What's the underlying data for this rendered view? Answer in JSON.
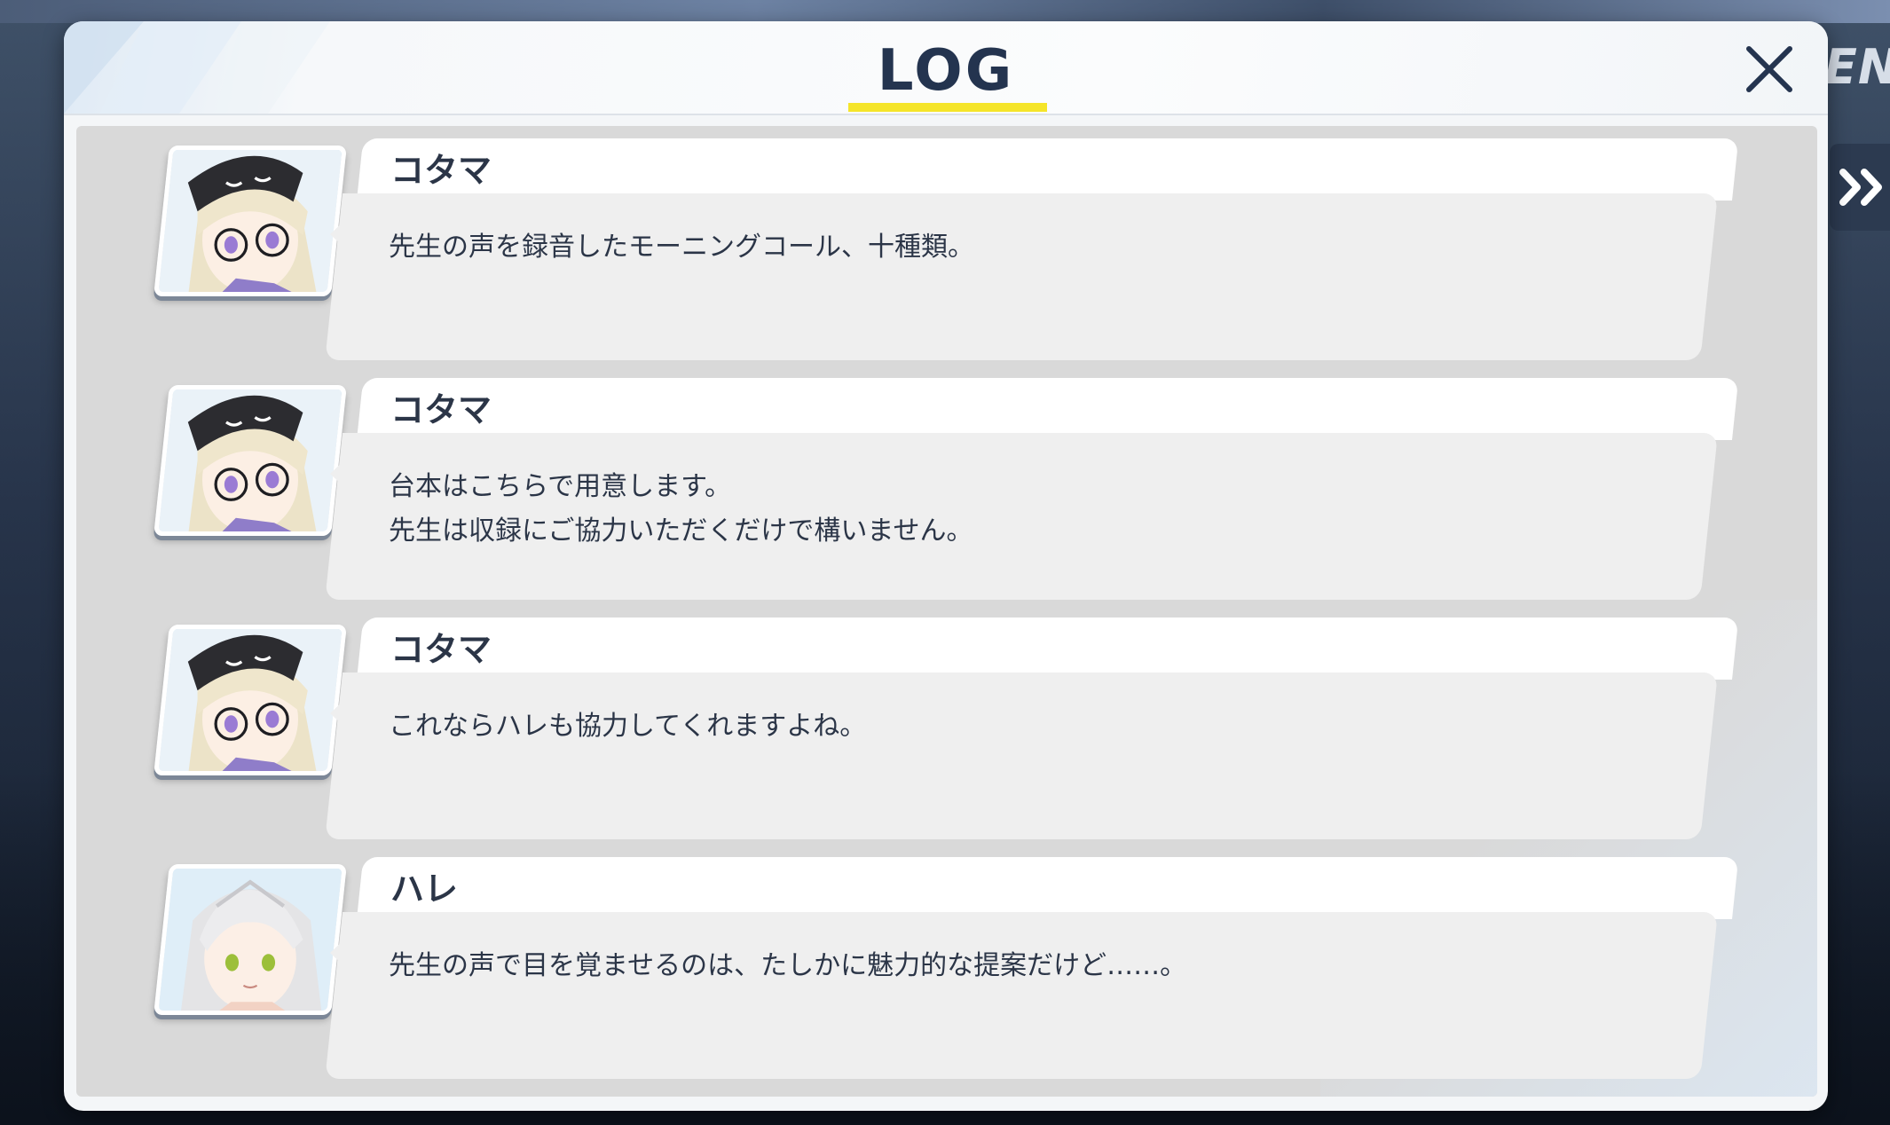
{
  "header": {
    "title": "LOG"
  },
  "background": {
    "menu_text": "ENU"
  },
  "log_entries": [
    {
      "speaker": "コタマ",
      "avatar": "kotama-portrait",
      "message": "先生の声を録音したモーニングコール、十種類。"
    },
    {
      "speaker": "コタマ",
      "avatar": "kotama-portrait",
      "message": "台本はこちらで用意します。\n先生は収録にご協力いただくだけで構いません。"
    },
    {
      "speaker": "コタマ",
      "avatar": "kotama-portrait",
      "message": "これならハレも協力してくれますよね。"
    },
    {
      "speaker": "ハレ",
      "avatar": "hare-portrait",
      "message": "先生の声で目を覚ませるのは、たしかに魅力的な提案だけど……。"
    }
  ],
  "colors": {
    "title": "#24344f",
    "accent_underline": "#f5e52a",
    "text": "#2b3547",
    "log_background": "#d9d9d9",
    "bubble": "#efefef"
  }
}
